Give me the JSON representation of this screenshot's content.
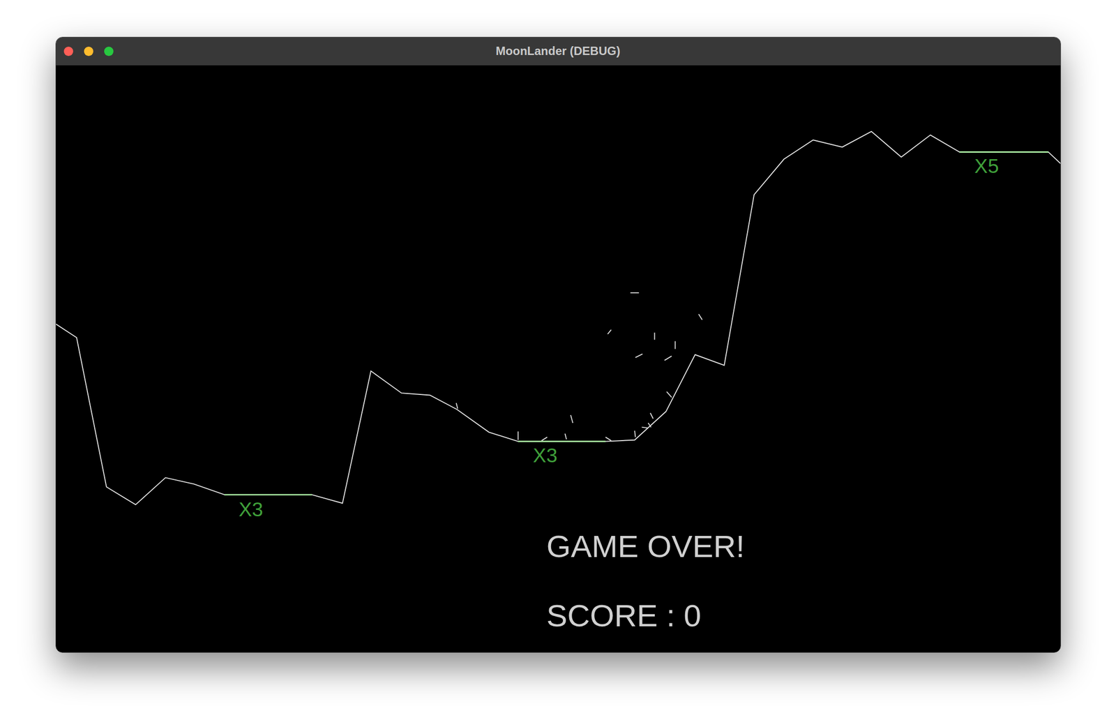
{
  "window": {
    "title": "MoonLander (DEBUG)"
  },
  "landing_pads": [
    {
      "label": "X3"
    },
    {
      "label": "X3"
    },
    {
      "label": "X5"
    }
  ],
  "message": "GAME OVER!",
  "score": "SCORE : 0"
}
